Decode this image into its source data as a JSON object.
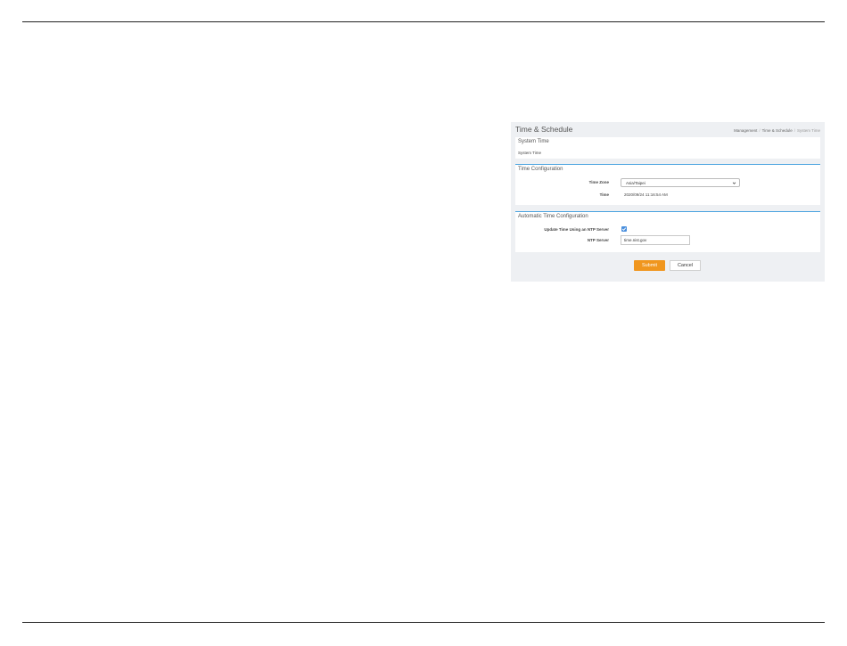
{
  "page": {
    "title": "Time & Schedule"
  },
  "breadcrumb": [
    "Management",
    "Time & Schedule",
    "System Time"
  ],
  "system_time_card": {
    "title": "System Time",
    "label": "System Time"
  },
  "time_config": {
    "title": "Time Configuration",
    "time_zone_label": "Time Zone",
    "time_zone_value": "Asia/Taipei",
    "time_label": "Time",
    "time_value": "2020/09/24 11:16:54 AM"
  },
  "auto_time_config": {
    "title": "Automatic Time Configuration",
    "ntp_update_label": "Update Time Using an NTP Server",
    "ntp_update_checked": true,
    "ntp_server_label": "NTP Server",
    "ntp_server_value": "time.nist.gov"
  },
  "buttons": {
    "submit": "Submit",
    "cancel": "Cancel"
  },
  "colors": {
    "accent": "#4aa3df",
    "submit": "#f0961e",
    "checkbox": "#4a8fdd",
    "panel_bg": "#eef0f3"
  }
}
